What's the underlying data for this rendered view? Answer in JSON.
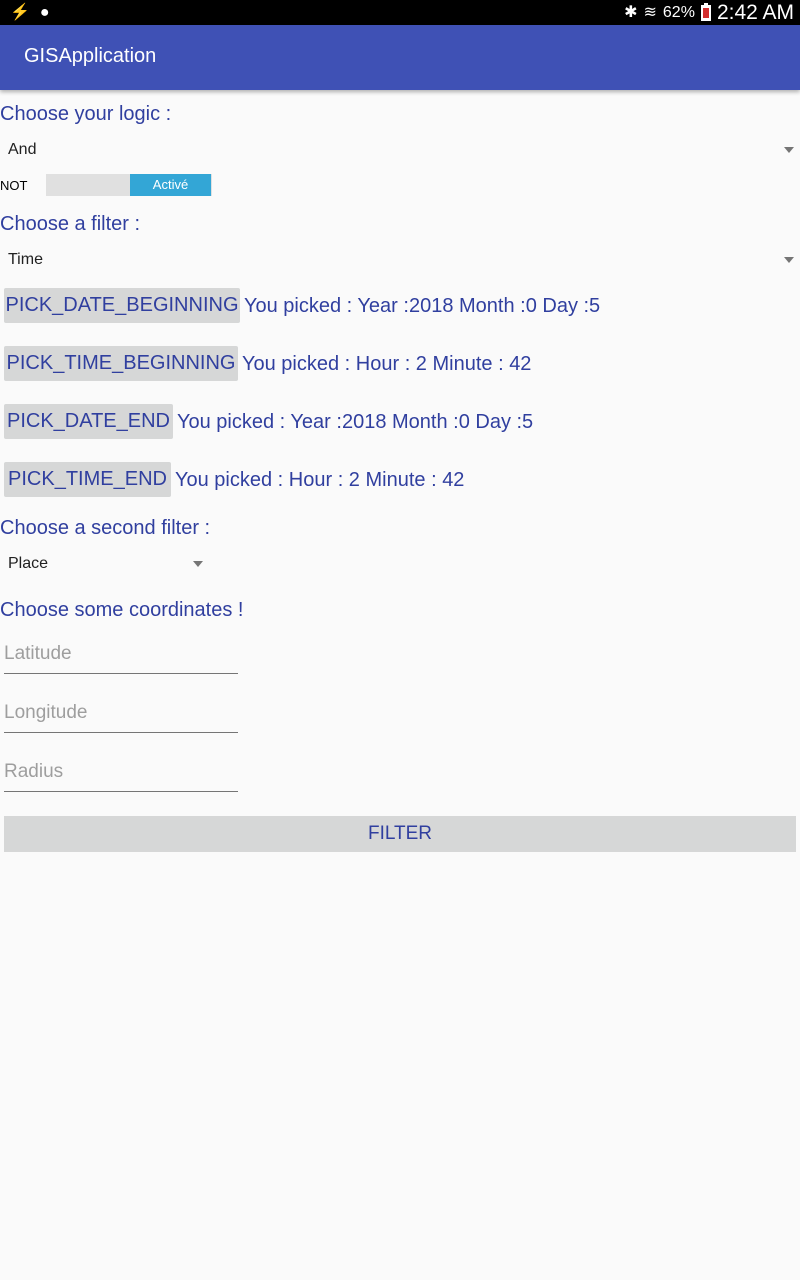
{
  "status_bar": {
    "left_icons": [
      "usb-icon",
      "app-notification-icon"
    ],
    "right_icons": [
      "bluetooth-icon",
      "wifi-icon",
      "battery-icon"
    ],
    "battery": "62%",
    "time": "2:42 AM"
  },
  "app_bar": {
    "title": "GISApplication"
  },
  "logic": {
    "label": "Choose your logic :",
    "selected": "And",
    "not_label": "NOT",
    "toggle_state": "Activé"
  },
  "filter": {
    "label": "Choose a filter :",
    "selected": "Time"
  },
  "pickers": [
    {
      "button": "PICK_DATE_BEGINNING",
      "result": "You picked : Year :2018 Month :0 Day :5"
    },
    {
      "button": "PICK_TIME_BEGINNING",
      "result": "You picked : Hour : 2 Minute : 42"
    },
    {
      "button": "PICK_DATE_END",
      "result": "You picked : Year :2018 Month :0 Day :5"
    },
    {
      "button": "PICK_TIME_END",
      "result": "You picked : Hour : 2 Minute : 42"
    }
  ],
  "second_filter": {
    "label": "Choose a second filter :",
    "selected": "Place"
  },
  "coordinates": {
    "label": "Choose some coordinates !",
    "latitude_placeholder": "Latitude",
    "longitude_placeholder": "Longitude",
    "radius_placeholder": "Radius"
  },
  "filter_button": "FILTER",
  "colors": {
    "app_bar": "#3f51b5",
    "label_text": "#303f9f",
    "toggle_on": "#33a6d6",
    "button_bg": "#d6d7d7"
  }
}
